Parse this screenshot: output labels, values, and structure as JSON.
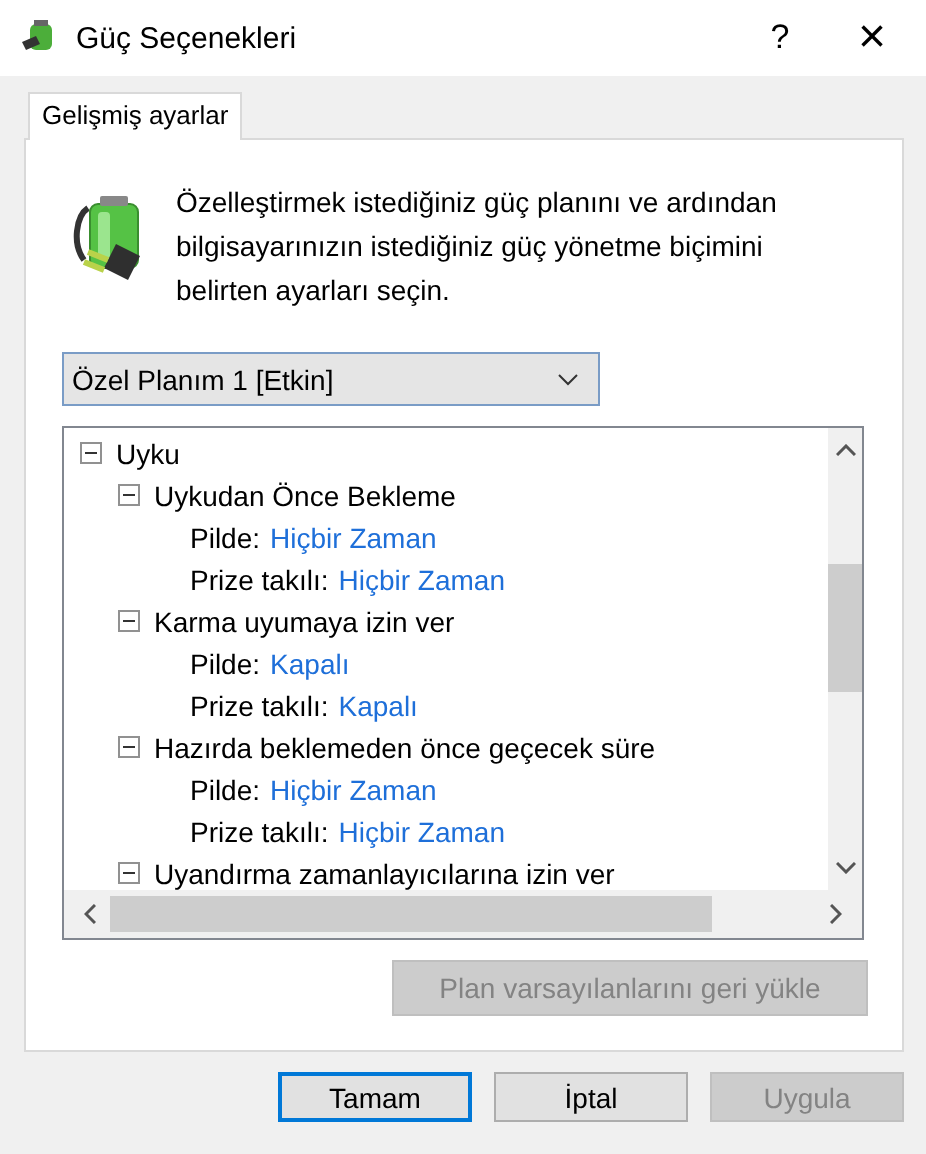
{
  "window": {
    "title": "Güç Seçenekleri",
    "help": "?",
    "close": "×"
  },
  "tabs": [
    {
      "label": "Gelişmiş ayarlar",
      "selected": true
    }
  ],
  "description": "Özelleştirmek istediğiniz güç planını ve ardından bilgisayarınızın istediğiniz güç yönetme biçimini belirten ayarları seçin.",
  "plan_dropdown": {
    "value": "Özel Planım 1 [Etkin]"
  },
  "tree": [
    {
      "label": "Uyku",
      "expanded": true,
      "children": [
        {
          "label": "Uykudan Önce Bekleme",
          "expanded": true,
          "settings": [
            {
              "label": "Pilde:",
              "value": "Hiçbir Zaman"
            },
            {
              "label": "Prize takılı:",
              "value": "Hiçbir Zaman"
            }
          ]
        },
        {
          "label": "Karma uyumaya izin ver",
          "expanded": true,
          "settings": [
            {
              "label": "Pilde:",
              "value": "Kapalı"
            },
            {
              "label": "Prize takılı:",
              "value": "Kapalı"
            }
          ]
        },
        {
          "label": "Hazırda beklemeden önce geçecek süre",
          "expanded": true,
          "settings": [
            {
              "label": "Pilde:",
              "value": "Hiçbir Zaman"
            },
            {
              "label": "Prize takılı:",
              "value": "Hiçbir Zaman"
            }
          ]
        },
        {
          "label": "Uyandırma zamanlayıcılarına izin ver",
          "expanded": true
        }
      ]
    }
  ],
  "restore_button": {
    "label": "Plan varsayılanlarını geri yükle",
    "disabled": true
  },
  "buttons": [
    {
      "label": "Tamam",
      "disabled": false,
      "default": true
    },
    {
      "label": "İptal",
      "disabled": false,
      "default": false
    },
    {
      "label": "Uygula",
      "disabled": true,
      "default": false
    }
  ]
}
